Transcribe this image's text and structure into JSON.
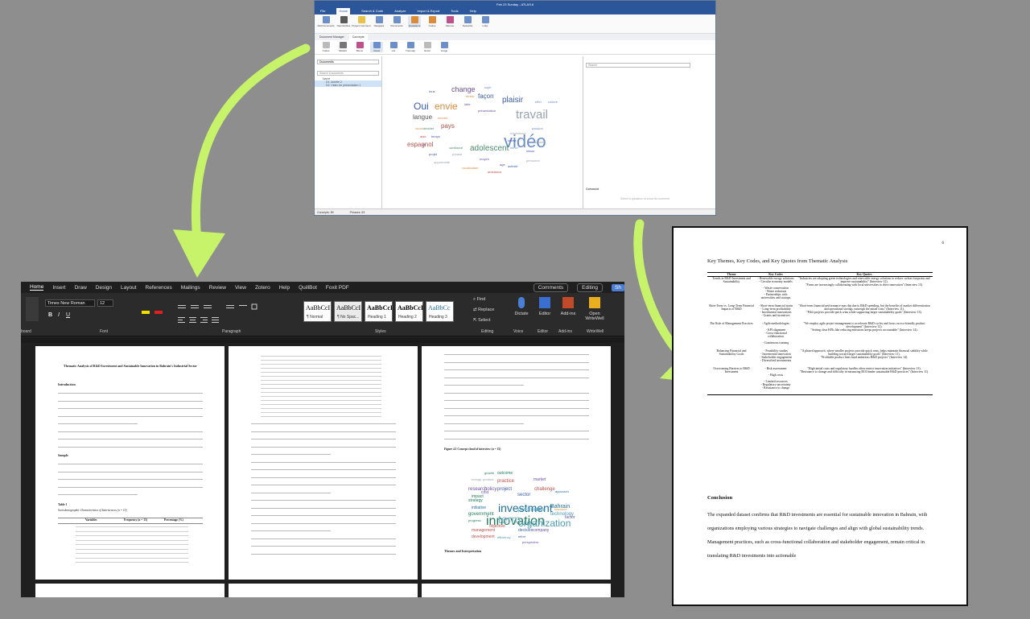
{
  "atlas": {
    "title": "Feb 23 Sunday - ATLAS.ti",
    "menu": [
      "File",
      "Home",
      "Search & Code",
      "Analyze",
      "Import & Export",
      "Tools",
      "Help"
    ],
    "active_menu": "Home",
    "ribbon": [
      "Add Documents",
      "New Entities",
      "Project Comment",
      "Navigator",
      "Documents",
      "Quotations",
      "Codes",
      "Memos",
      "Networks",
      "Links"
    ],
    "tabs": [
      "Document Manager",
      "Concepts"
    ],
    "tools": [
      "Codes",
      "Models",
      "Memo",
      "Cloud",
      "List",
      "Treemap",
      "Excel",
      "Image"
    ],
    "doc_filter": "Documents",
    "search_docs": "Search Documents",
    "doc_col": "Name",
    "docs": [
      "D1: Aclette 2",
      "D2: Video de presentation 1"
    ],
    "search_right": "Search",
    "comment_label": "Comment",
    "comment_hint": "Select a quotation to show its comment",
    "status_left": "Concepts: 89",
    "status_mid": "Phrases: 63",
    "cloud_words": [
      {
        "t": "vidéo",
        "c": "#6c8fc9"
      },
      {
        "t": "travail",
        "c": "#9aa3b0"
      },
      {
        "t": "Oui",
        "c": "#3b5ba9"
      },
      {
        "t": "envie",
        "c": "#d98c3a"
      },
      {
        "t": "change",
        "c": "#6a4fa3"
      },
      {
        "t": "façon",
        "c": "#3b5ba9"
      },
      {
        "t": "plaisir",
        "c": "#3b5ba9"
      },
      {
        "t": "langue",
        "c": "#555"
      },
      {
        "t": "pays",
        "c": "#b0504a"
      },
      {
        "t": "adolescent",
        "c": "#4a8a6a"
      },
      {
        "t": "espagnol",
        "c": "#c0504a"
      },
      {
        "t": "sujet",
        "c": "#6c8fc9"
      },
      {
        "t": "tous",
        "c": "#3b5ba9"
      },
      {
        "t": "erreur",
        "c": "#d98c3a"
      },
      {
        "t": "idée",
        "c": "#6a4fa3"
      },
      {
        "t": "effet",
        "c": "#6c8fc9"
      },
      {
        "t": "culture",
        "c": "#6c8fc9"
      },
      {
        "t": "chose",
        "c": "#3b5ba9"
      },
      {
        "t": "retour",
        "c": "#3b5ba9"
      },
      {
        "t": "élève",
        "c": "#6c8fc9"
      },
      {
        "t": "confiance",
        "c": "#4a8a6a"
      },
      {
        "t": "projet",
        "c": "#3b5ba9"
      },
      {
        "t": "phrase",
        "c": "#9aa3b0"
      },
      {
        "t": "moyen",
        "c": "#6a4fa3"
      },
      {
        "t": "vocabulaire",
        "c": "#d98c3a"
      },
      {
        "t": "activité",
        "c": "#3b5ba9"
      },
      {
        "t": "passion",
        "c": "#6c8fc9"
      },
      {
        "t": "expérience",
        "c": "#9aa3b0"
      },
      {
        "t": "présentation",
        "c": "#6a4fa3"
      },
      {
        "t": "mentre",
        "c": "#d98c3a"
      },
      {
        "t": "nécessaire",
        "c": "#9aa3b0"
      },
      {
        "t": "personne",
        "c": "#9aa3b0"
      },
      {
        "t": "opportunité",
        "c": "#9aa3b0"
      },
      {
        "t": "ambiance",
        "c": "#c0504a"
      },
      {
        "t": "age",
        "c": "#6a4fa3"
      },
      {
        "t": "aide",
        "c": "#c0504a"
      },
      {
        "t": "temps",
        "c": "#3b5ba9"
      },
      {
        "t": "vie",
        "c": "#3b5ba9"
      },
      {
        "t": "cours",
        "c": "#d98c3a"
      },
      {
        "t": "décider",
        "c": "#4a8a6a"
      }
    ]
  },
  "word": {
    "menu": [
      "Home",
      "Insert",
      "Draw",
      "Design",
      "Layout",
      "References",
      "Mailings",
      "Review",
      "View",
      "Zotero",
      "Help",
      "QuillBot",
      "Foxit PDF"
    ],
    "active_menu": "Home",
    "comments_btn": "Comments",
    "editing_btn": "Editing",
    "share_btn": "Sh",
    "font_name": "Times New Roman",
    "font_size": "12",
    "styles": [
      {
        "preview": "AaBbCcI",
        "name": "¶ Normal"
      },
      {
        "preview": "AaBbCcI",
        "name": "¶ No Spac..."
      },
      {
        "preview": "AaBbCcI",
        "name": "Heading 1"
      },
      {
        "preview": "AaBbCcI",
        "name": "Heading 2"
      },
      {
        "preview": "AaBbCc",
        "name": "Heading 3"
      }
    ],
    "find": "Find",
    "replace": "Replace",
    "select": "Select",
    "dictate": "Dictate",
    "editor": "Editor",
    "addins": "Add-ins",
    "writewell": "Open WriteWell",
    "groups": [
      "board",
      "Font",
      "Paragraph",
      "Styles",
      "Editing",
      "Voice",
      "Editor",
      "Add-ins",
      "WriteWell"
    ],
    "page1": {
      "title": "Thematic Analysis of R&D Investment and Sustainable Innovation in Bahrain's Industrial Sector",
      "h_intro": "Introduction",
      "h_sample": "Sample",
      "table_label": "Table 1",
      "table_caption": "Sociodemographic Characteristics of Interviewees (n = 15)",
      "table_head": [
        "Variables",
        "Frequency (n = 15)",
        "Percentage (%)"
      ]
    },
    "page3": {
      "figure": "Figure 4.1 Concept cloud of interview (n = 15)",
      "h_themes": "Themes and Interpretation",
      "cloud_words": [
        {
          "t": "investment",
          "c": "#1f6f9f"
        },
        {
          "t": "innovation",
          "c": "#1f7a5c"
        },
        {
          "t": "organization",
          "c": "#4a9ab5"
        },
        {
          "t": "term",
          "c": "#7fb3c8"
        },
        {
          "t": "sector",
          "c": "#3b5ba9"
        },
        {
          "t": "project",
          "c": "#3b5ba9"
        },
        {
          "t": "policy",
          "c": "#6a4fa3"
        },
        {
          "t": "research",
          "c": "#6a4fa3"
        },
        {
          "t": "performance",
          "c": "#4a9ab5"
        },
        {
          "t": "Bahrain",
          "c": "#1f6f9f"
        },
        {
          "t": "technology",
          "c": "#4a9ab5"
        },
        {
          "t": "challenge",
          "c": "#c0504a"
        },
        {
          "t": "practice",
          "c": "#c0504a"
        },
        {
          "t": "market",
          "c": "#6a4fa3"
        },
        {
          "t": "government",
          "c": "#1f7a5c"
        },
        {
          "t": "decision",
          "c": "#3b5ba9"
        },
        {
          "t": "management",
          "c": "#c0504a"
        },
        {
          "t": "strategy",
          "c": "#1f7a5c"
        },
        {
          "t": "initiative",
          "c": "#1f6f9f"
        },
        {
          "t": "growth",
          "c": "#1f7a5c"
        },
        {
          "t": "impact",
          "c": "#1f7a5c"
        },
        {
          "t": "goal",
          "c": "#4a9ab5"
        },
        {
          "t": "resource",
          "c": "#d98c3a"
        },
        {
          "t": "factor",
          "c": "#6a4fa3"
        },
        {
          "t": "effort",
          "c": "#3b5ba9"
        },
        {
          "t": "company",
          "c": "#6a4fa3"
        },
        {
          "t": "development",
          "c": "#c0504a"
        },
        {
          "t": "efficiency",
          "c": "#4a9ab5"
        },
        {
          "t": "outcome",
          "c": "#1f7a5c"
        },
        {
          "t": "cost",
          "c": "#6a4fa3"
        },
        {
          "t": "approach",
          "c": "#1f6f9f"
        },
        {
          "t": "objective",
          "c": "#c0504a"
        },
        {
          "t": "progress",
          "c": "#1f7a5c"
        },
        {
          "t": "energy",
          "c": "#9aa3b0"
        },
        {
          "t": "product",
          "c": "#9aa3b0"
        },
        {
          "t": "perspective",
          "c": "#6a4fa3"
        }
      ]
    }
  },
  "doc": {
    "page_no": "6",
    "heading": "Key Themes, Key Codes, and Key Quotes from Thematic Analysis",
    "cols": [
      "Theme",
      "Key Codes",
      "Key Quotes"
    ],
    "rows": [
      {
        "theme": "Trends in R&D Investment and Sustainability",
        "codes": "- Renewable energy solutions\n- Circular economy models\n\n- Waste conservation\n- Waste reduction\n- Partnerships with universities and startups",
        "quotes": "\"Industries are adopting green technologies and renewable energy solutions to reduce carbon footprints and improve sustainability\" (Interview 12).\n\"Firms are increasingly collaborating with local universities to drive innovation\" (Interview 15)."
      },
      {
        "theme": "Short-Term vs. Long-Term Financial Impacts of R&D",
        "codes": "- Short-term financial strain\n- Long-term profitability\n- Incremental innovations\n- Grants and incentives",
        "quotes": "\"Short-term financial performance may dip due to R&D spending, but the benefits of market differentiation and operational savings outweigh the initial costs\" (Interview 11).\n\"Pilot projects provide quick wins while supporting larger sustainability goals\" (Interview 13)."
      },
      {
        "theme": "The Role of Management Practices",
        "codes": "- Agile methodologies\n\n- KPI alignment\n- Cross-functional collaboration\n\n- Continuous training",
        "quotes": "\"We employ agile project management to accelerate R&D cycles and focus on eco-friendly product development\" (Interview 12).\n\"Setting clear KPIs like reducing emissions keeps projects accountable\" (Interview 14)."
      },
      {
        "theme": "Balancing Financial and Sustainability Goals",
        "codes": "- Feasibility studies\n- Incremental innovation\n- Stakeholder engagement\n- Diversified investments",
        "quotes": "\"A phased approach, where smaller projects provide quick wins, helps maintain financial stability while building toward larger sustainability goals\" (Interview 11).\n\"Profitable product lines fund ambitious R&D projects\" (Interview 14)."
      },
      {
        "theme": "Overcoming Barriers to R&D Investment",
        "codes": "- Risk assessment\n\n- High costs\n\n- Limited resources\n- Regulatory uncertainty\n- Resistance to change",
        "quotes": "\"High initial costs and regulatory hurdles often restrict innovation initiatives\" (Interview 13).\n\"Resistance to change and difficulty in measuring ROI hinder sustainable R&D practices\" (Interview 11)."
      }
    ],
    "conclusion_heading": "Conclusion",
    "conclusion_text": "The expanded dataset confirms that R&D investments are essential for sustainable innovation in Bahrain, with organizations employing various strategies to navigate challenges and align with global sustainability trends. Management practices, such as cross-functional collaboration and stakeholder engagement, remain critical in translating R&D investments into actionable"
  },
  "colors": {
    "background": "#8e8e8e",
    "arrow": "#c6f36a",
    "atlas_blue": "#2b579a",
    "word_dark": "#1f1f1f"
  }
}
